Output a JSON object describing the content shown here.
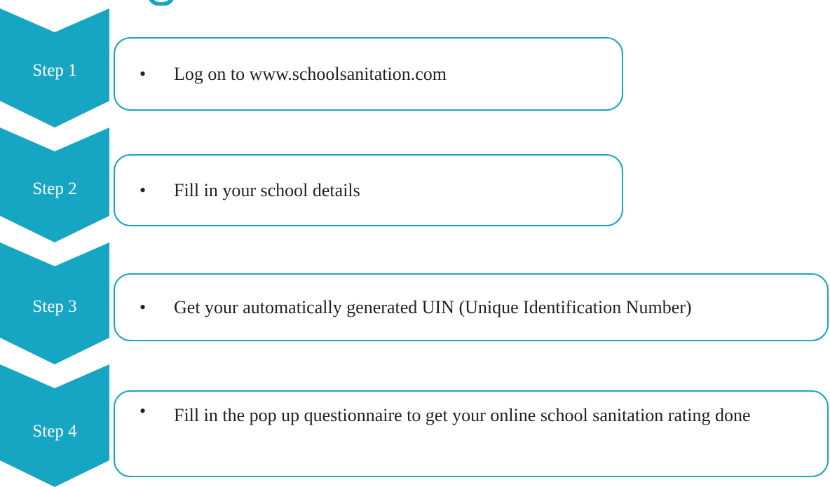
{
  "colors": {
    "chevron_fill": "#17a5c4",
    "box_border": "#17a5c4",
    "body_text": "#231f20"
  },
  "steps": [
    {
      "label": "Step 1",
      "bullet": "•",
      "text": "Log on to www.schoolsanitation.com"
    },
    {
      "label": "Step 2",
      "bullet": "•",
      "text": "Fill in your school details"
    },
    {
      "label": "Step 3",
      "bullet": "•",
      "text": "Get your automatically generated UIN (Unique Identification Number)"
    },
    {
      "label": "Step 4",
      "bullet": "•",
      "text": "Fill in the pop up questionnaire to get your online school sanitation rating done"
    }
  ]
}
